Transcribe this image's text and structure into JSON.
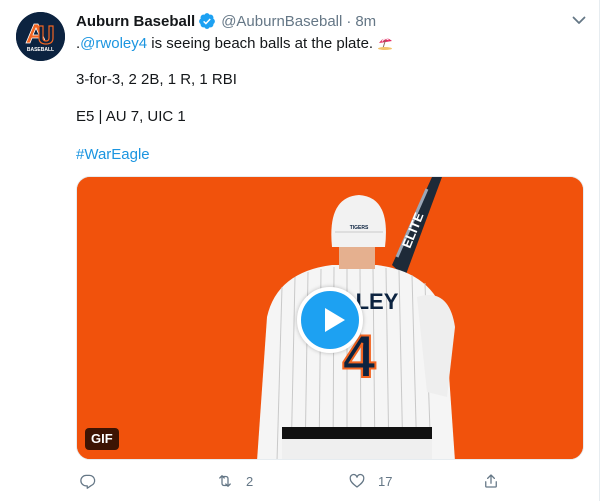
{
  "tweet": {
    "display_name": "Auburn Baseball",
    "handle": "@AuburnBaseball",
    "separator": "·",
    "time": "8m",
    "text_prefix": ".",
    "mention": "@rwoley4",
    "text_after_mention": " is seeing beach balls at the plate.",
    "emoji": "beach-with-umbrella-emoji",
    "line2": "3-for-3, 2 2B, 1 R, 1 RBI",
    "line3": "E5 | AU 7, UIC 1",
    "hashtag": "#WarEagle"
  },
  "avatar": {
    "logo": "auburn-AU-logo",
    "logo_text": "BASEBALL",
    "colors": {
      "navy": "#0c2340",
      "orange": "#f26522"
    }
  },
  "media": {
    "type": "gif",
    "badge": "GIF",
    "background_color": "#f1520c",
    "jersey_name": "LEY",
    "jersey_number": "4",
    "bat_text": "ELITE",
    "cap_text": "TIGERS",
    "play_button_color": "#1da1f2"
  },
  "actions": {
    "reply_count": "",
    "retweet_count": "2",
    "like_count": "17"
  },
  "colors": {
    "link": "#1b95e0",
    "secondary": "#657786",
    "text": "#14171a",
    "verified": "#1da1f2"
  }
}
